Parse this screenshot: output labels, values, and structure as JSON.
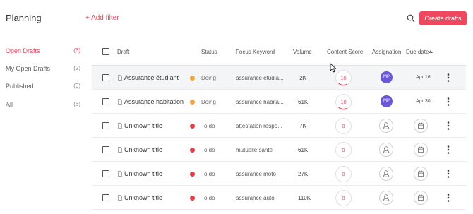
{
  "header": {
    "title": "Planning",
    "add_filter": "+ Add filter",
    "create_button": "Create drafts"
  },
  "sidebar": {
    "items": [
      {
        "label": "Open Drafts",
        "count": "(6)",
        "active": true
      },
      {
        "label": "My Open Drafts",
        "count": "(2)",
        "active": false
      },
      {
        "label": "Published",
        "count": "(0)",
        "active": false
      },
      {
        "label": "All",
        "count": "(6)",
        "active": false
      }
    ]
  },
  "table": {
    "columns": {
      "draft": "Draft",
      "status": "Status",
      "focus_keyword": "Focus Keyword",
      "volume": "Volume",
      "content_score": "Content Score",
      "assignation": "Assignation",
      "due_date": "Due date"
    },
    "rows": [
      {
        "draft": "Assurance étudiant",
        "status": "Doing",
        "status_color": "#f0a23b",
        "keyword": "assurance étudia...",
        "volume": "2K",
        "score": "10",
        "assignee": "MP",
        "due": "Apr 16"
      },
      {
        "draft": "Assurance habitation",
        "status": "Doing",
        "status_color": "#f0a23b",
        "keyword": "assurance habita...",
        "volume": "61K",
        "score": "10",
        "assignee": "MP",
        "due": "Apr 30"
      },
      {
        "draft": "Unknown title",
        "status": "To do",
        "status_color": "#dc4148",
        "keyword": "attestation respo...",
        "volume": "7K",
        "score": "0",
        "assignee": "",
        "due": ""
      },
      {
        "draft": "Unknown title",
        "status": "To do",
        "status_color": "#dc4148",
        "keyword": "mutuelle santé",
        "volume": "61K",
        "score": "0",
        "assignee": "",
        "due": ""
      },
      {
        "draft": "Unknown title",
        "status": "To do",
        "status_color": "#dc4148",
        "keyword": "assurance moto",
        "volume": "27K",
        "score": "0",
        "assignee": "",
        "due": ""
      },
      {
        "draft": "Unknown title",
        "status": "To do",
        "status_color": "#dc4148",
        "keyword": "assurance auto",
        "volume": "110K",
        "score": "0",
        "assignee": "",
        "due": ""
      }
    ]
  },
  "colors": {
    "accent": "#f0475f",
    "avatar": "#6a58d6",
    "doing": "#f0a23b",
    "todo": "#dc4148"
  },
  "icons": [
    "search-icon",
    "document-icon",
    "user-icon",
    "calendar-icon",
    "kebab-menu-icon",
    "sort-ascending-icon",
    "mouse-cursor-icon"
  ]
}
